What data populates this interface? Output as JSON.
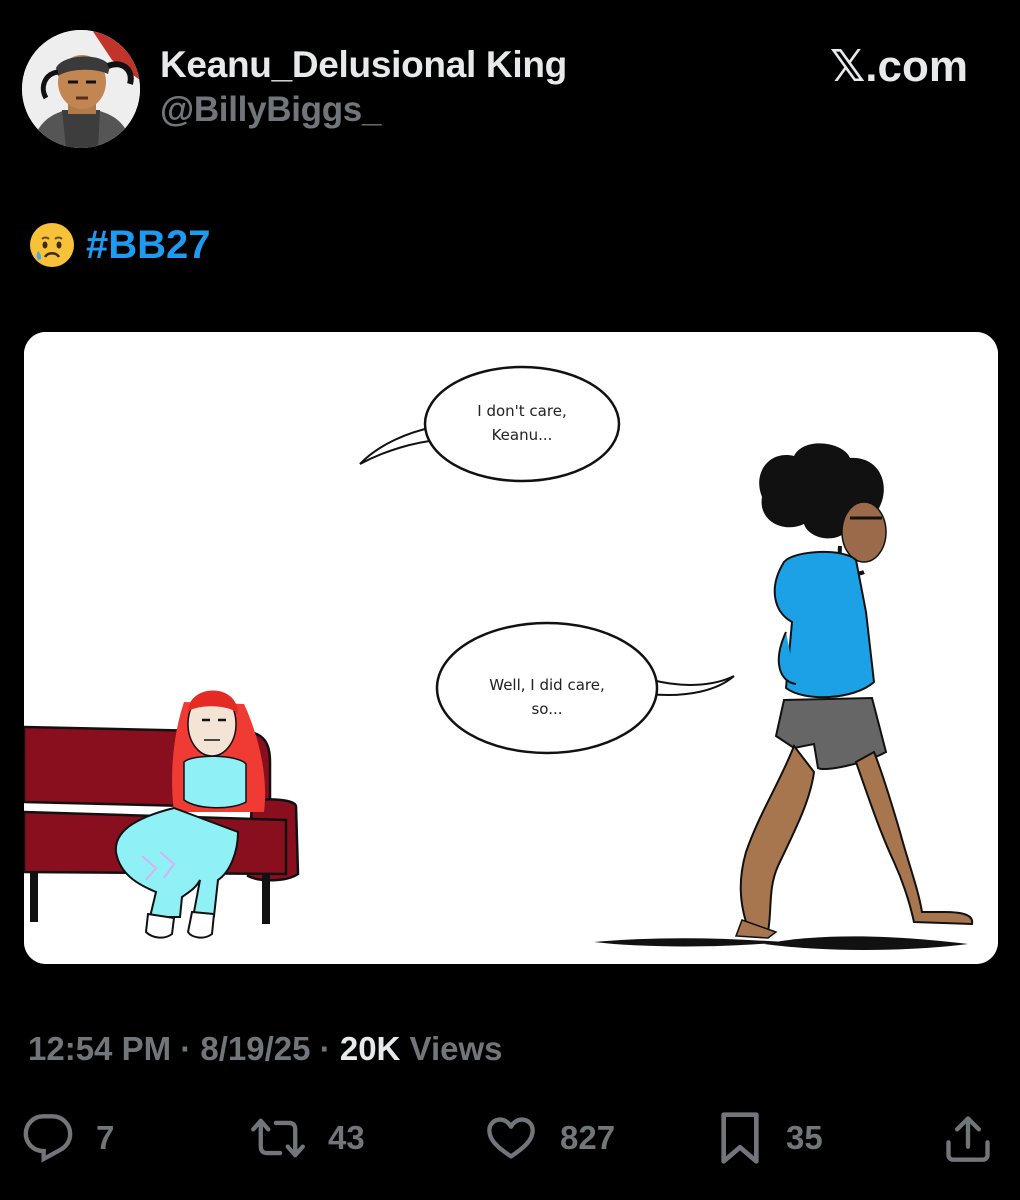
{
  "post": {
    "author": {
      "display_name": "Keanu_Delusional King",
      "handle": "@BillyBiggs_"
    },
    "source_brand": "𝕏.com",
    "text": {
      "emoji": "crying-face",
      "hashtag": "#BB27"
    },
    "media": {
      "bubble_top": [
        "I don't care,",
        "Keanu..."
      ],
      "bubble_bottom": [
        "Well, I did care,",
        "so..."
      ]
    },
    "meta": {
      "time": "12:54 PM",
      "separator": " · ",
      "date": "8/19/25",
      "views_count": "20K",
      "views_label": " Views"
    },
    "actions": {
      "replies": "7",
      "reposts": "43",
      "likes": "827",
      "bookmarks": "35"
    }
  },
  "colors": {
    "background": "#000000",
    "primary_text": "#e7e9ea",
    "secondary_text": "#71767b",
    "link": "#1d9bf0"
  },
  "icons": [
    "reply-icon",
    "repost-icon",
    "like-icon",
    "bookmark-icon",
    "share-icon"
  ]
}
